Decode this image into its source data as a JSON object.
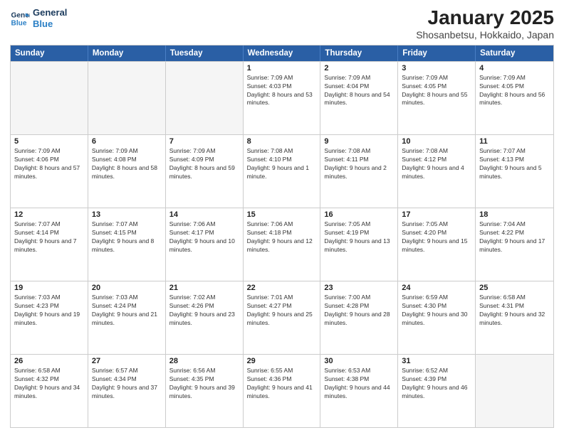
{
  "logo": {
    "line1": "General",
    "line2": "Blue"
  },
  "title": "January 2025",
  "subtitle": "Shosanbetsu, Hokkaido, Japan",
  "weekdays": [
    "Sunday",
    "Monday",
    "Tuesday",
    "Wednesday",
    "Thursday",
    "Friday",
    "Saturday"
  ],
  "weeks": [
    [
      {
        "day": "",
        "info": ""
      },
      {
        "day": "",
        "info": ""
      },
      {
        "day": "",
        "info": ""
      },
      {
        "day": "1",
        "info": "Sunrise: 7:09 AM\nSunset: 4:03 PM\nDaylight: 8 hours and 53 minutes."
      },
      {
        "day": "2",
        "info": "Sunrise: 7:09 AM\nSunset: 4:04 PM\nDaylight: 8 hours and 54 minutes."
      },
      {
        "day": "3",
        "info": "Sunrise: 7:09 AM\nSunset: 4:05 PM\nDaylight: 8 hours and 55 minutes."
      },
      {
        "day": "4",
        "info": "Sunrise: 7:09 AM\nSunset: 4:05 PM\nDaylight: 8 hours and 56 minutes."
      }
    ],
    [
      {
        "day": "5",
        "info": "Sunrise: 7:09 AM\nSunset: 4:06 PM\nDaylight: 8 hours and 57 minutes."
      },
      {
        "day": "6",
        "info": "Sunrise: 7:09 AM\nSunset: 4:08 PM\nDaylight: 8 hours and 58 minutes."
      },
      {
        "day": "7",
        "info": "Sunrise: 7:09 AM\nSunset: 4:09 PM\nDaylight: 8 hours and 59 minutes."
      },
      {
        "day": "8",
        "info": "Sunrise: 7:08 AM\nSunset: 4:10 PM\nDaylight: 9 hours and 1 minute."
      },
      {
        "day": "9",
        "info": "Sunrise: 7:08 AM\nSunset: 4:11 PM\nDaylight: 9 hours and 2 minutes."
      },
      {
        "day": "10",
        "info": "Sunrise: 7:08 AM\nSunset: 4:12 PM\nDaylight: 9 hours and 4 minutes."
      },
      {
        "day": "11",
        "info": "Sunrise: 7:07 AM\nSunset: 4:13 PM\nDaylight: 9 hours and 5 minutes."
      }
    ],
    [
      {
        "day": "12",
        "info": "Sunrise: 7:07 AM\nSunset: 4:14 PM\nDaylight: 9 hours and 7 minutes."
      },
      {
        "day": "13",
        "info": "Sunrise: 7:07 AM\nSunset: 4:15 PM\nDaylight: 9 hours and 8 minutes."
      },
      {
        "day": "14",
        "info": "Sunrise: 7:06 AM\nSunset: 4:17 PM\nDaylight: 9 hours and 10 minutes."
      },
      {
        "day": "15",
        "info": "Sunrise: 7:06 AM\nSunset: 4:18 PM\nDaylight: 9 hours and 12 minutes."
      },
      {
        "day": "16",
        "info": "Sunrise: 7:05 AM\nSunset: 4:19 PM\nDaylight: 9 hours and 13 minutes."
      },
      {
        "day": "17",
        "info": "Sunrise: 7:05 AM\nSunset: 4:20 PM\nDaylight: 9 hours and 15 minutes."
      },
      {
        "day": "18",
        "info": "Sunrise: 7:04 AM\nSunset: 4:22 PM\nDaylight: 9 hours and 17 minutes."
      }
    ],
    [
      {
        "day": "19",
        "info": "Sunrise: 7:03 AM\nSunset: 4:23 PM\nDaylight: 9 hours and 19 minutes."
      },
      {
        "day": "20",
        "info": "Sunrise: 7:03 AM\nSunset: 4:24 PM\nDaylight: 9 hours and 21 minutes."
      },
      {
        "day": "21",
        "info": "Sunrise: 7:02 AM\nSunset: 4:26 PM\nDaylight: 9 hours and 23 minutes."
      },
      {
        "day": "22",
        "info": "Sunrise: 7:01 AM\nSunset: 4:27 PM\nDaylight: 9 hours and 25 minutes."
      },
      {
        "day": "23",
        "info": "Sunrise: 7:00 AM\nSunset: 4:28 PM\nDaylight: 9 hours and 28 minutes."
      },
      {
        "day": "24",
        "info": "Sunrise: 6:59 AM\nSunset: 4:30 PM\nDaylight: 9 hours and 30 minutes."
      },
      {
        "day": "25",
        "info": "Sunrise: 6:58 AM\nSunset: 4:31 PM\nDaylight: 9 hours and 32 minutes."
      }
    ],
    [
      {
        "day": "26",
        "info": "Sunrise: 6:58 AM\nSunset: 4:32 PM\nDaylight: 9 hours and 34 minutes."
      },
      {
        "day": "27",
        "info": "Sunrise: 6:57 AM\nSunset: 4:34 PM\nDaylight: 9 hours and 37 minutes."
      },
      {
        "day": "28",
        "info": "Sunrise: 6:56 AM\nSunset: 4:35 PM\nDaylight: 9 hours and 39 minutes."
      },
      {
        "day": "29",
        "info": "Sunrise: 6:55 AM\nSunset: 4:36 PM\nDaylight: 9 hours and 41 minutes."
      },
      {
        "day": "30",
        "info": "Sunrise: 6:53 AM\nSunset: 4:38 PM\nDaylight: 9 hours and 44 minutes."
      },
      {
        "day": "31",
        "info": "Sunrise: 6:52 AM\nSunset: 4:39 PM\nDaylight: 9 hours and 46 minutes."
      },
      {
        "day": "",
        "info": ""
      }
    ]
  ]
}
